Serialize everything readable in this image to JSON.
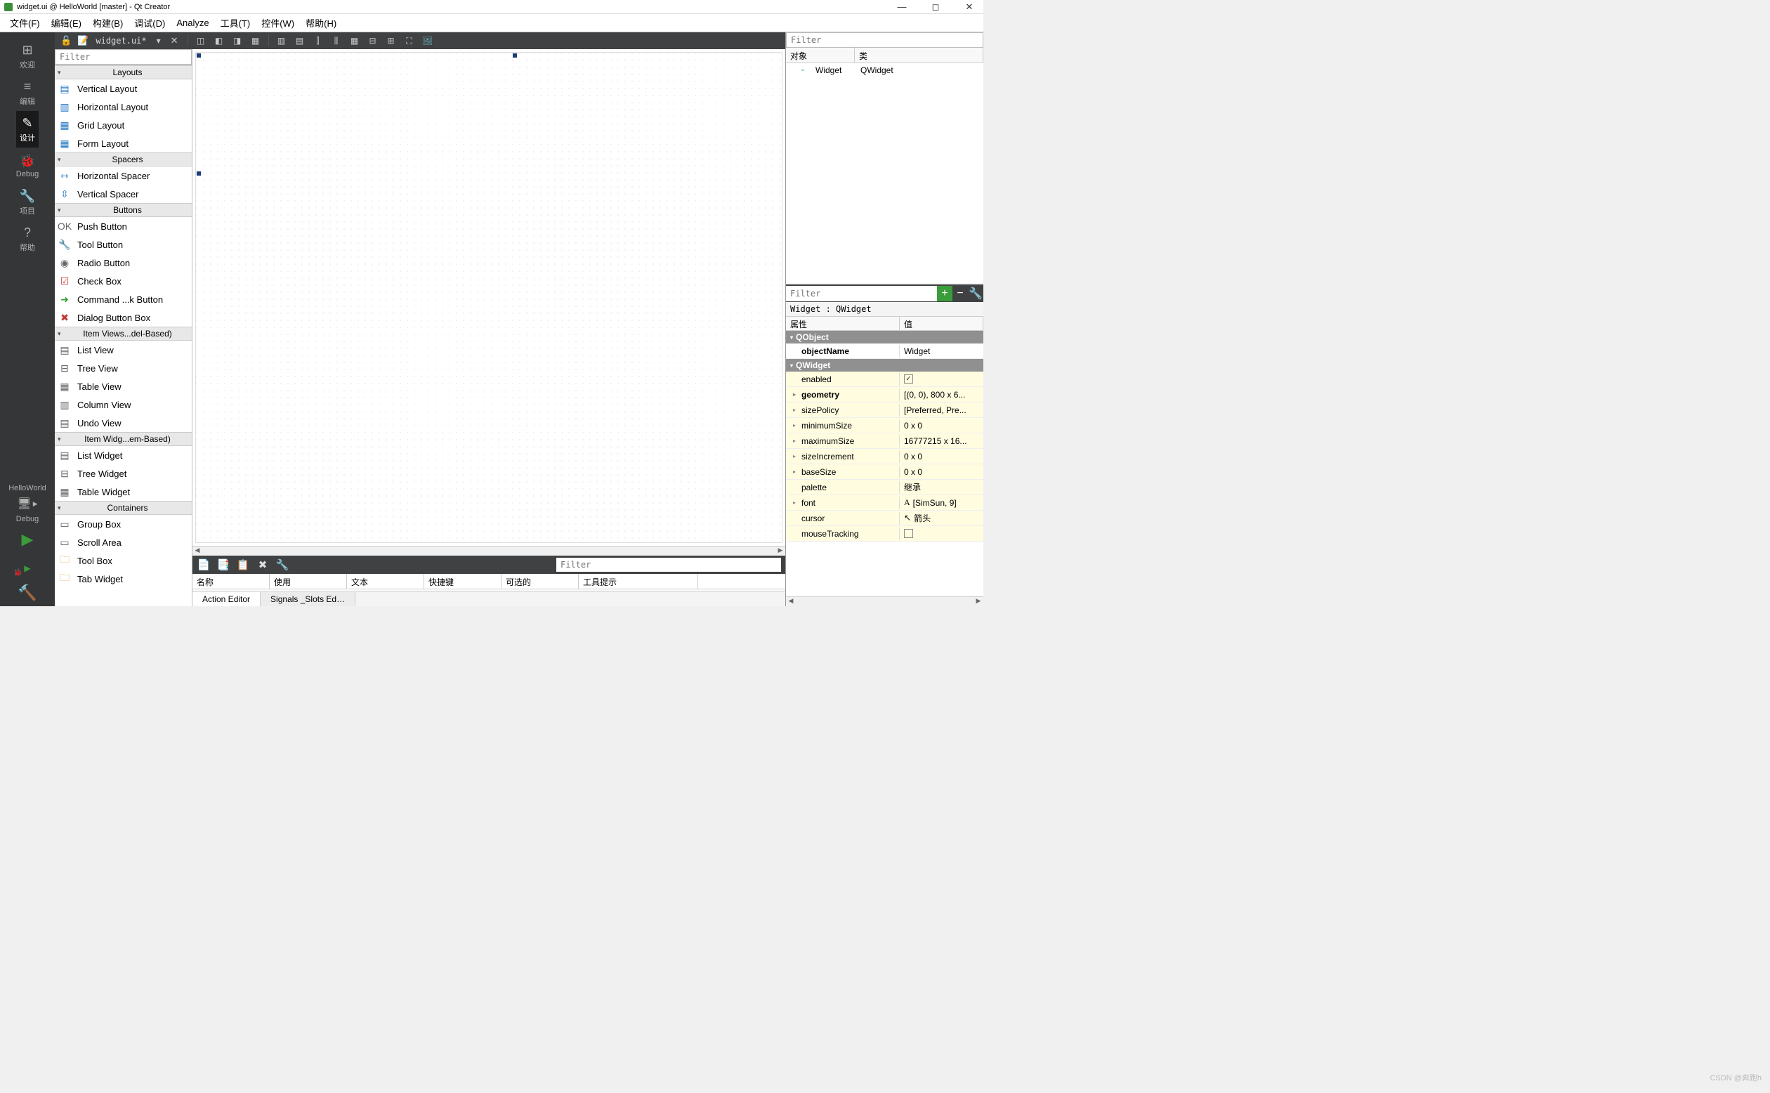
{
  "window": {
    "title": "widget.ui @ HelloWorld [master] - Qt Creator"
  },
  "menubar": [
    "文件(F)",
    "编辑(E)",
    "构建(B)",
    "调试(D)",
    "Analyze",
    "工具(T)",
    "控件(W)",
    "帮助(H)"
  ],
  "sidebar": {
    "modes": [
      {
        "label": "欢迎",
        "icon": "⊞"
      },
      {
        "label": "编辑",
        "icon": "≡"
      },
      {
        "label": "设计",
        "icon": "✎",
        "active": true
      },
      {
        "label": "Debug",
        "icon": "🐞"
      },
      {
        "label": "项目",
        "icon": "🔧"
      },
      {
        "label": "帮助",
        "icon": "?"
      }
    ],
    "project": "HelloWorld",
    "debugLabel": "Debug"
  },
  "fileTab": {
    "filename": "widget.ui*"
  },
  "widgetBox": {
    "filterPlaceholder": "Filter",
    "categories": [
      {
        "name": "Layouts",
        "items": [
          {
            "label": "Vertical Layout",
            "icon": "▤",
            "cls": "ic-blue"
          },
          {
            "label": "Horizontal Layout",
            "icon": "▥",
            "cls": "ic-blue"
          },
          {
            "label": "Grid Layout",
            "icon": "▦",
            "cls": "ic-blue"
          },
          {
            "label": "Form Layout",
            "icon": "▦",
            "cls": "ic-blue"
          }
        ]
      },
      {
        "name": "Spacers",
        "items": [
          {
            "label": "Horizontal Spacer",
            "icon": "⇿",
            "cls": "ic-blue"
          },
          {
            "label": "Vertical Spacer",
            "icon": "⇳",
            "cls": "ic-blue"
          }
        ]
      },
      {
        "name": "Buttons",
        "items": [
          {
            "label": "Push Button",
            "icon": "OK",
            "cls": "ic-gray"
          },
          {
            "label": "Tool Button",
            "icon": "🔧",
            "cls": "ic-gray"
          },
          {
            "label": "Radio Button",
            "icon": "◉",
            "cls": "ic-gray"
          },
          {
            "label": "Check Box",
            "icon": "☑",
            "cls": "ic-red"
          },
          {
            "label": "Command ...k Button",
            "icon": "➜",
            "cls": "ic-green"
          },
          {
            "label": "Dialog Button Box",
            "icon": "✖",
            "cls": "ic-red"
          }
        ]
      },
      {
        "name": "Item Views...del-Based)",
        "items": [
          {
            "label": "List View",
            "icon": "▤",
            "cls": "ic-gray"
          },
          {
            "label": "Tree View",
            "icon": "⊟",
            "cls": "ic-gray"
          },
          {
            "label": "Table View",
            "icon": "▦",
            "cls": "ic-gray"
          },
          {
            "label": "Column View",
            "icon": "▥",
            "cls": "ic-gray"
          },
          {
            "label": "Undo View",
            "icon": "▤",
            "cls": "ic-gray"
          }
        ]
      },
      {
        "name": "Item Widg...em-Based)",
        "items": [
          {
            "label": "List Widget",
            "icon": "▤",
            "cls": "ic-gray"
          },
          {
            "label": "Tree Widget",
            "icon": "⊟",
            "cls": "ic-gray"
          },
          {
            "label": "Table Widget",
            "icon": "▦",
            "cls": "ic-gray"
          }
        ]
      },
      {
        "name": "Containers",
        "items": [
          {
            "label": "Group Box",
            "icon": "▭",
            "cls": "ic-gray"
          },
          {
            "label": "Scroll Area",
            "icon": "▭",
            "cls": "ic-gray"
          },
          {
            "label": "Tool Box",
            "icon": "🗀",
            "cls": "ic-orange"
          },
          {
            "label": "Tab Widget",
            "icon": "🗀",
            "cls": "ic-orange"
          }
        ]
      }
    ]
  },
  "actionEditor": {
    "filterPlaceholder": "Filter",
    "columns": [
      "名称",
      "使用",
      "文本",
      "快捷键",
      "可选的",
      "工具提示"
    ],
    "tabs": [
      "Action Editor",
      "Signals _Slots Ed…"
    ]
  },
  "objectInspector": {
    "filterPlaceholder": "Filter",
    "headers": [
      "对象",
      "类"
    ],
    "rows": [
      {
        "name": "Widget",
        "class": "QWidget"
      }
    ]
  },
  "propertyEditor": {
    "filterPlaceholder": "Filter",
    "classLine": "Widget : QWidget",
    "headers": [
      "属性",
      "值"
    ],
    "groups": [
      {
        "name": "QObject",
        "rows": [
          {
            "name": "objectName",
            "value": "Widget",
            "bold": true
          }
        ]
      },
      {
        "name": "QWidget",
        "rows": [
          {
            "name": "enabled",
            "value": "",
            "check": true,
            "yellow": true
          },
          {
            "name": "geometry",
            "value": "[(0, 0), 800 x 6...",
            "bold": true,
            "expandable": true,
            "yellow": true
          },
          {
            "name": "sizePolicy",
            "value": "[Preferred, Pre...",
            "expandable": true,
            "yellow": true
          },
          {
            "name": "minimumSize",
            "value": "0 x 0",
            "expandable": true,
            "yellow": true
          },
          {
            "name": "maximumSize",
            "value": "16777215 x 16...",
            "expandable": true,
            "yellow": true
          },
          {
            "name": "sizeIncrement",
            "value": "0 x 0",
            "expandable": true,
            "yellow": true
          },
          {
            "name": "baseSize",
            "value": "0 x 0",
            "expandable": true,
            "yellow": true
          },
          {
            "name": "palette",
            "value": "继承",
            "yellow": true
          },
          {
            "name": "font",
            "value": "[SimSun, 9]",
            "expandable": true,
            "yellow": true,
            "prefixIcon": "A"
          },
          {
            "name": "cursor",
            "value": "箭头",
            "yellow": true,
            "prefixIcon": "↖"
          },
          {
            "name": "mouseTracking",
            "value": "",
            "check": false,
            "yellow": true
          }
        ]
      }
    ]
  },
  "watermark": "CSDN @奔跑h"
}
